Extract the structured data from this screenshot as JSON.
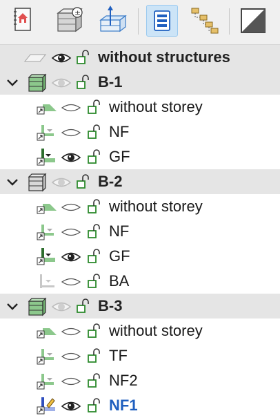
{
  "toolbar": {
    "buttons": [
      {
        "icon": "house-notebook-icon"
      },
      {
        "icon": "storey-settings-icon"
      },
      {
        "icon": "building-axis-icon"
      },
      {
        "icon": "list-view-icon",
        "active": true
      },
      {
        "icon": "hierarchy-folders-icon"
      },
      {
        "icon": "diagonal-split-icon"
      }
    ]
  },
  "tree": {
    "root": {
      "label": "without structures",
      "eye": "visible",
      "lock": "unlocked"
    },
    "buildings": [
      {
        "label": "B-1",
        "icon": "building-green-icon",
        "eye": "hidden",
        "lock": "unlocked",
        "storeys": [
          {
            "label": "without storey",
            "icon": "storey-ramp-icon",
            "eye": "closed",
            "lock": "unlocked"
          },
          {
            "label": "NF",
            "icon": "storey-side-icon",
            "eye": "closed",
            "lock": "unlocked"
          },
          {
            "label": "GF",
            "icon": "storey-ground-icon",
            "eye": "visible",
            "lock": "unlocked"
          }
        ]
      },
      {
        "label": "B-2",
        "icon": "building-grey-icon",
        "eye": "hidden",
        "lock": "unlocked",
        "storeys": [
          {
            "label": "without storey",
            "icon": "storey-ramp-icon",
            "eye": "closed",
            "lock": "unlocked"
          },
          {
            "label": "NF",
            "icon": "storey-side-icon",
            "eye": "closed",
            "lock": "unlocked"
          },
          {
            "label": "GF",
            "icon": "storey-ground-icon",
            "eye": "visible",
            "lock": "unlocked"
          },
          {
            "label": "BA",
            "icon": "storey-basement-icon",
            "eye": "closed",
            "lock": "unlocked"
          }
        ]
      },
      {
        "label": "B-3",
        "icon": "building-green-icon",
        "eye": "hidden",
        "lock": "unlocked",
        "storeys": [
          {
            "label": "without storey",
            "icon": "storey-ramp-icon",
            "eye": "closed",
            "lock": "unlocked"
          },
          {
            "label": "TF",
            "icon": "storey-side-icon",
            "eye": "closed",
            "lock": "unlocked"
          },
          {
            "label": "NF2",
            "icon": "storey-side-icon",
            "eye": "closed",
            "lock": "unlocked"
          },
          {
            "label": "NF1",
            "icon": "storey-current-icon",
            "eye": "visible",
            "lock": "unlocked",
            "current": true
          }
        ]
      }
    ]
  },
  "colors": {
    "building_row": "#e5e5e5",
    "current_storey_text": "#1f5fbf",
    "lock_green": "#2e8b2e",
    "storey_green": "#8cc88c"
  }
}
